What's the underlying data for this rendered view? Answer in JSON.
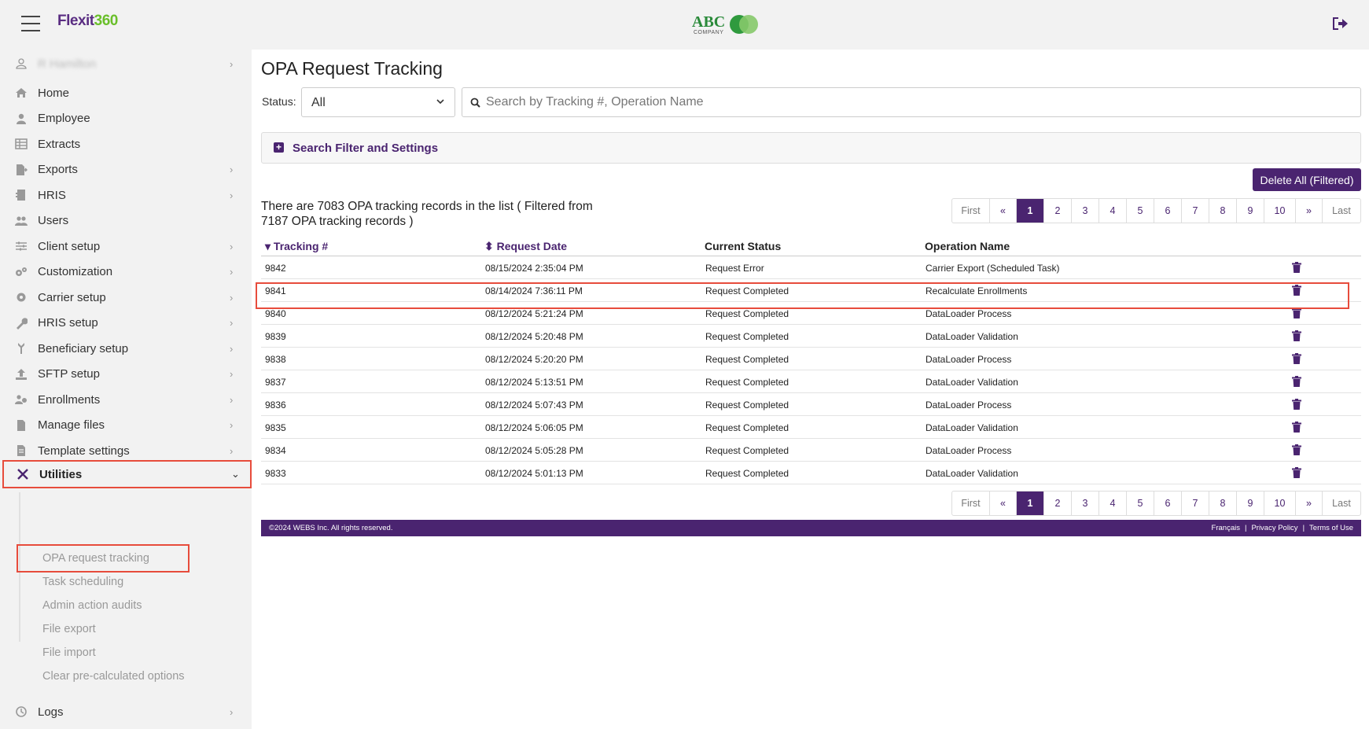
{
  "header": {
    "brand_part1": "Flexit",
    "brand_part2": "360",
    "company_logo_text": "ABC",
    "company_logo_sub": "COMPANY"
  },
  "sidebar": {
    "user_name": "R Hamilton",
    "items": [
      {
        "label": "Home",
        "icon": "home-icon",
        "chevron": false
      },
      {
        "label": "Employee",
        "icon": "user-icon",
        "chevron": false
      },
      {
        "label": "Extracts",
        "icon": "table-icon",
        "chevron": false
      },
      {
        "label": "Exports",
        "icon": "file-export-icon",
        "chevron": true
      },
      {
        "label": "HRIS",
        "icon": "hris-icon",
        "chevron": true
      },
      {
        "label": "Users",
        "icon": "users-icon",
        "chevron": false
      },
      {
        "label": "Client setup",
        "icon": "sliders-icon",
        "chevron": true
      },
      {
        "label": "Customization",
        "icon": "cogs-icon",
        "chevron": true
      },
      {
        "label": "Carrier setup",
        "icon": "gear-icon",
        "chevron": true
      },
      {
        "label": "HRIS setup",
        "icon": "wrench-icon",
        "chevron": true
      },
      {
        "label": "Beneficiary setup",
        "icon": "beneficiary-icon",
        "chevron": true
      },
      {
        "label": "SFTP setup",
        "icon": "upload-icon",
        "chevron": true
      },
      {
        "label": "Enrollments",
        "icon": "enrollments-icon",
        "chevron": true
      },
      {
        "label": "Manage files",
        "icon": "file-icon",
        "chevron": true
      },
      {
        "label": "Template settings",
        "icon": "template-icon",
        "chevron": true
      }
    ],
    "utilities_label": "Utilities",
    "sub_items": [
      "OPA request tracking",
      "Task scheduling",
      "Admin action audits",
      "File export",
      "File import",
      "Clear pre-calculated options"
    ],
    "logs_label": "Logs"
  },
  "main": {
    "title": "OPA Request Tracking",
    "status_label": "Status:",
    "status_value": "All",
    "search_placeholder": "Search by Tracking #, Operation Name",
    "filter_label": "Search Filter and Settings",
    "delete_all_label": "Delete All (Filtered)",
    "records_text": "There are 7083 OPA tracking records in the list ( Filtered from 7187 OPA tracking records )",
    "pager": [
      "First",
      "«",
      "1",
      "2",
      "3",
      "4",
      "5",
      "6",
      "7",
      "8",
      "9",
      "10",
      "»",
      "Last"
    ],
    "active_page": "1",
    "columns": {
      "tracking": "Tracking #",
      "request_date": "Request Date",
      "current_status": "Current Status",
      "operation_name": "Operation Name"
    },
    "rows": [
      {
        "tracking": "9842",
        "date": "08/15/2024 2:35:04 PM",
        "status": "Request Error",
        "operation": "Carrier Export (Scheduled Task)"
      },
      {
        "tracking": "9841",
        "date": "08/14/2024 7:36:11 PM",
        "status": "Request Completed",
        "operation": "Recalculate Enrollments"
      },
      {
        "tracking": "9840",
        "date": "08/12/2024 5:21:24 PM",
        "status": "Request Completed",
        "operation": "DataLoader Process"
      },
      {
        "tracking": "9839",
        "date": "08/12/2024 5:20:48 PM",
        "status": "Request Completed",
        "operation": "DataLoader Validation"
      },
      {
        "tracking": "9838",
        "date": "08/12/2024 5:20:20 PM",
        "status": "Request Completed",
        "operation": "DataLoader Process"
      },
      {
        "tracking": "9837",
        "date": "08/12/2024 5:13:51 PM",
        "status": "Request Completed",
        "operation": "DataLoader Validation"
      },
      {
        "tracking": "9836",
        "date": "08/12/2024 5:07:43 PM",
        "status": "Request Completed",
        "operation": "DataLoader Process"
      },
      {
        "tracking": "9835",
        "date": "08/12/2024 5:06:05 PM",
        "status": "Request Completed",
        "operation": "DataLoader Validation"
      },
      {
        "tracking": "9834",
        "date": "08/12/2024 5:05:28 PM",
        "status": "Request Completed",
        "operation": "DataLoader Process"
      },
      {
        "tracking": "9833",
        "date": "08/12/2024 5:01:13 PM",
        "status": "Request Completed",
        "operation": "DataLoader Validation"
      }
    ]
  },
  "footer": {
    "copyright": "©2024 WEBS Inc. All rights reserved.",
    "link_french": "Français",
    "link_privacy": "Privacy Policy",
    "link_terms": "Terms of Use"
  },
  "colors": {
    "accent": "#4a2470",
    "highlight": "#e74c3c",
    "brand_green": "#6abf2a"
  }
}
